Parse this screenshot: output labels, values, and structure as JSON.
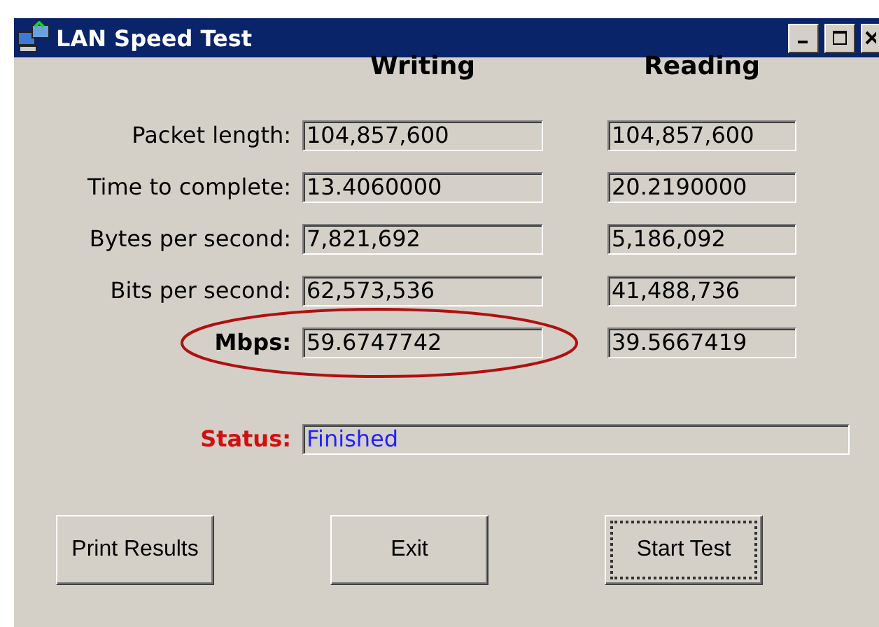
{
  "window": {
    "title": "LAN Speed Test"
  },
  "columns": [
    "Writing",
    "Reading"
  ],
  "rows": [
    {
      "label": "Packet length:",
      "emphasized": false,
      "highlighted": false,
      "writing": "104,857,600",
      "reading": "104,857,600"
    },
    {
      "label": "Time to complete:",
      "emphasized": false,
      "highlighted": false,
      "writing": "13.4060000",
      "reading": "20.2190000"
    },
    {
      "label": "Bytes per second:",
      "emphasized": false,
      "highlighted": false,
      "writing": "7,821,692",
      "reading": "5,186,092"
    },
    {
      "label": "Bits per second:",
      "emphasized": false,
      "highlighted": false,
      "writing": "62,573,536",
      "reading": "41,488,736"
    },
    {
      "label": "Mbps:",
      "emphasized": true,
      "highlighted": true,
      "writing": "59.6747742",
      "reading": "39.5667419"
    }
  ],
  "status": {
    "label": "Status:",
    "value": "Finished"
  },
  "buttons": [
    {
      "label": "Print Results",
      "focused": false
    },
    {
      "label": "Exit",
      "focused": false
    },
    {
      "label": "Start Test",
      "focused": true
    }
  ]
}
